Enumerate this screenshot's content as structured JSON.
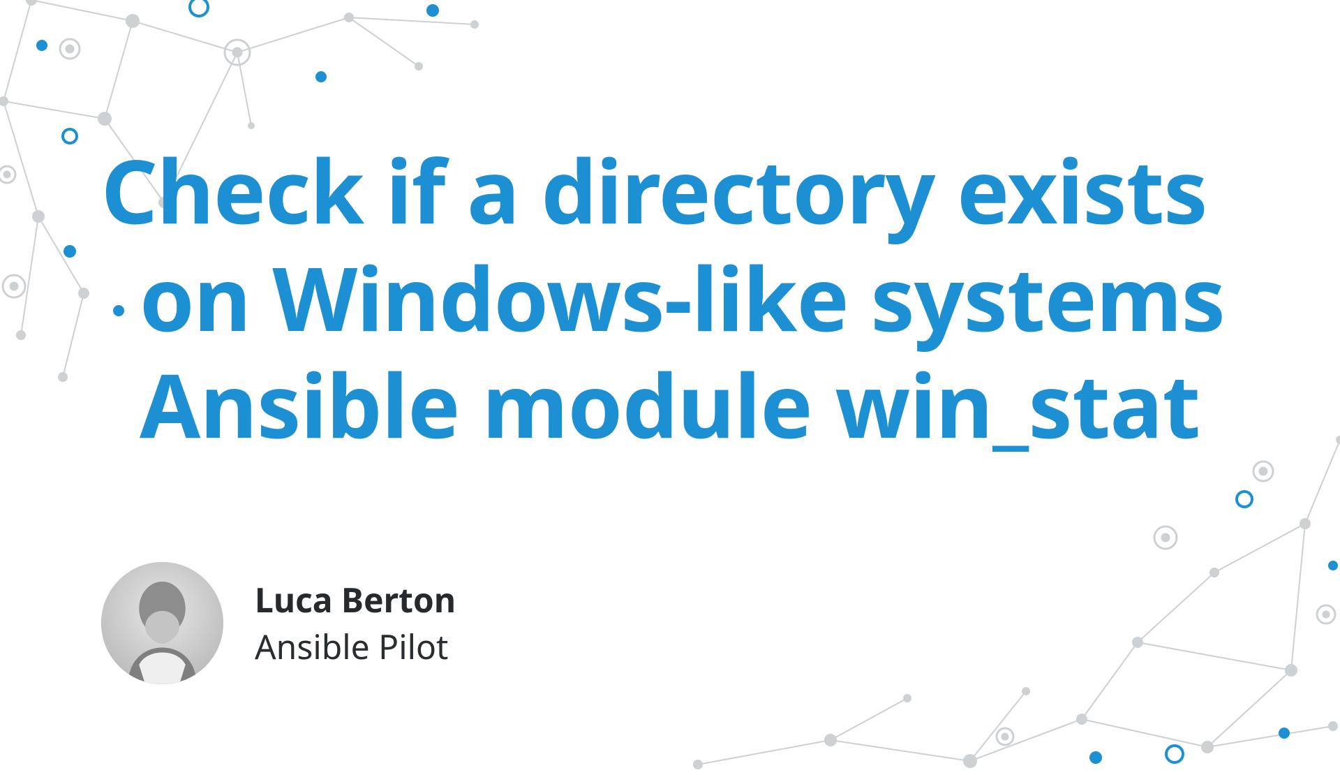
{
  "heading": {
    "line1": "Check if a directory exists",
    "line2": "on Windows-like systems",
    "line3": "Ansible module win_stat"
  },
  "author": {
    "name": "Luca Berton",
    "title": "Ansible Pilot"
  },
  "colors": {
    "accent": "#1d8fd3",
    "text_dark": "#272a2d",
    "text_light": "#2a2d30",
    "graph_gray": "#c6cbcd"
  }
}
